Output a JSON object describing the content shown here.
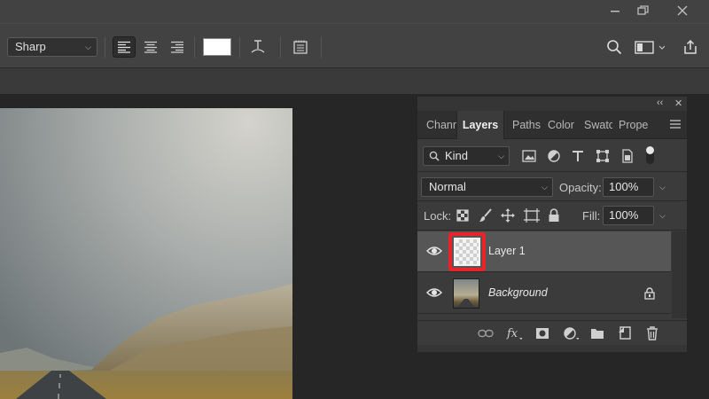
{
  "window": {
    "minimize_icon": "minimize-icon",
    "restore_icon": "restore-icon",
    "close_icon": "close-icon"
  },
  "options_bar": {
    "antialias_value": "Sharp",
    "align_left_icon": "align-left-icon",
    "align_center_icon": "align-center-icon",
    "align_right_icon": "align-right-icon",
    "text_color": "#ffffff",
    "warp_text_icon": "warp-text-icon",
    "character_panel_icon": "character-panel-icon",
    "search_icon": "search-icon",
    "workspace_icon": "workspace-icon",
    "share_icon": "share-icon"
  },
  "layers_panel": {
    "collapse_label": "‹‹",
    "close_label": "✕",
    "tabs": [
      {
        "label": "Chann",
        "active": false
      },
      {
        "label": "Layers",
        "active": true
      },
      {
        "label": "Paths",
        "active": false
      },
      {
        "label": "Color",
        "active": false
      },
      {
        "label": "Swatc",
        "active": false
      },
      {
        "label": "Prope",
        "active": false
      }
    ],
    "filter": {
      "value": "Kind"
    },
    "blend_mode": "Normal",
    "opacity_label": "Opacity:",
    "opacity_value": "100%",
    "lock_label": "Lock:",
    "fill_label": "Fill:",
    "fill_value": "100%",
    "layers": [
      {
        "name": "Layer 1",
        "selected": true,
        "visible": true,
        "locked": false
      },
      {
        "name": "Background",
        "selected": false,
        "visible": true,
        "locked": true
      }
    ],
    "highlight_color": "#e8232a"
  }
}
